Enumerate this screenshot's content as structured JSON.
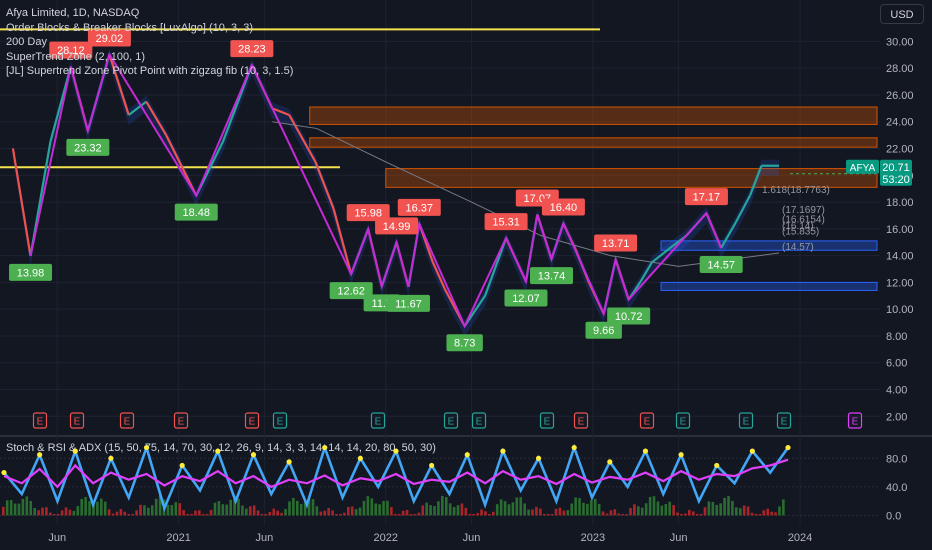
{
  "header": {
    "title": "Afya Limited, 1D, NASDAQ",
    "indicators": [
      "Order Blocks & Breaker Blocks [LuxAlgo] (10, 3, 3)",
      "200 Day",
      "SuperTrend Zone (2, 100, 1)",
      "[JL] Supertrend Zone Pivot Point with zigzag fib (10, 3, 1.5)"
    ],
    "currency_button": "USD"
  },
  "colors": {
    "background": "#131722",
    "grid": "#1f2230",
    "zigzag": "#c62ad6",
    "high_label": "#f05350",
    "low_label": "#4caf50",
    "bull": "#26a69a",
    "bear": "#ef5350",
    "yellow_line": "#f5e34e",
    "orange_zone": "#d35400",
    "blue_zone": "#2962ff",
    "ticker_tag": "#089981"
  },
  "chart_data": [
    {
      "type": "line",
      "title": "Afya Limited, 1D, NASDAQ",
      "ticker": "AFYA",
      "last_price": "20.71",
      "countdown": "53:20",
      "x_axis_labels": [
        "Jun",
        "2021",
        "Jun",
        "2022",
        "Jun",
        "2023",
        "Jun",
        "2024"
      ],
      "y_ticks": [
        2,
        4,
        6,
        8,
        10,
        12,
        14,
        16,
        18,
        20,
        22,
        24,
        26,
        28,
        30
      ],
      "ylim": [
        1.5,
        31
      ],
      "grid": true,
      "x": [
        "2020-03-15",
        "2020-04-15",
        "2020-05-20",
        "2020-06-25",
        "2020-07-25",
        "2020-09-01",
        "2020-10-05",
        "2020-11-05",
        "2020-12-10",
        "2021-02-01",
        "2021-03-20",
        "2021-05-10",
        "2021-06-15",
        "2021-07-15",
        "2021-08-30",
        "2021-10-01",
        "2021-11-01",
        "2021-12-01",
        "2021-12-25",
        "2022-01-20",
        "2022-02-10",
        "2022-03-01",
        "2022-03-25",
        "2022-04-15",
        "2022-05-20",
        "2022-06-25",
        "2022-08-01",
        "2022-09-05",
        "2022-09-25",
        "2022-10-20",
        "2022-11-10",
        "2022-12-01",
        "2022-12-25",
        "2023-01-20",
        "2023-02-10",
        "2023-03-05",
        "2023-03-25",
        "2023-04-15",
        "2023-05-15",
        "2023-06-15",
        "2023-07-20",
        "2023-08-15",
        "2023-09-10",
        "2023-10-05",
        "2023-10-25",
        "2023-11-25"
      ],
      "series": [
        {
          "name": "Close",
          "values": [
            22.0,
            13.98,
            22.5,
            28.12,
            23.32,
            29.02,
            24.5,
            25.5,
            23.0,
            18.48,
            22.5,
            28.23,
            25.0,
            24.5,
            21.0,
            17.5,
            12.62,
            15.98,
            11.7,
            14.99,
            11.67,
            16.37,
            13.5,
            11.5,
            8.73,
            11.0,
            15.31,
            12.07,
            17.07,
            13.74,
            16.4,
            14.5,
            12.0,
            9.66,
            13.71,
            10.72,
            12.0,
            13.5,
            14.5,
            15.5,
            17.17,
            14.57,
            16.5,
            18.5,
            20.71,
            20.71
          ]
        }
      ],
      "zigzag_pivots": [
        {
          "date": "2020-04-15",
          "value": 13.98,
          "label": "13.98",
          "kind": "low"
        },
        {
          "date": "2020-06-25",
          "value": 28.12,
          "label": "28.12",
          "kind": "high"
        },
        {
          "date": "2020-07-25",
          "value": 23.32,
          "label": "23.32",
          "kind": "low"
        },
        {
          "date": "2020-09-01",
          "value": 29.02,
          "label": "29.02",
          "kind": "high"
        },
        {
          "date": "2021-02-01",
          "value": 18.48,
          "label": "18.48",
          "kind": "low"
        },
        {
          "date": "2021-05-10",
          "value": 28.23,
          "label": "28.23",
          "kind": "high"
        },
        {
          "date": "2021-11-01",
          "value": 12.62,
          "label": "12.62",
          "kind": "low"
        },
        {
          "date": "2021-12-01",
          "value": 15.98,
          "label": "15.98",
          "kind": "high"
        },
        {
          "date": "2021-12-25",
          "value": 11.7,
          "label": "11.7",
          "kind": "low"
        },
        {
          "date": "2022-01-20",
          "value": 14.99,
          "label": "14.99",
          "kind": "high"
        },
        {
          "date": "2022-02-10",
          "value": 11.67,
          "label": "11.67",
          "kind": "low"
        },
        {
          "date": "2022-03-01",
          "value": 16.37,
          "label": "16.37",
          "kind": "high"
        },
        {
          "date": "2022-05-20",
          "value": 8.73,
          "label": "8.73",
          "kind": "low"
        },
        {
          "date": "2022-08-01",
          "value": 15.31,
          "label": "15.31",
          "kind": "high"
        },
        {
          "date": "2022-09-05",
          "value": 12.07,
          "label": "12.07",
          "kind": "low"
        },
        {
          "date": "2022-09-25",
          "value": 17.07,
          "label": "17.07",
          "kind": "high"
        },
        {
          "date": "2022-10-20",
          "value": 13.74,
          "label": "13.74",
          "kind": "low"
        },
        {
          "date": "2022-11-10",
          "value": 16.4,
          "label": "16.40",
          "kind": "high"
        },
        {
          "date": "2023-01-20",
          "value": 9.66,
          "label": "9.66",
          "kind": "low"
        },
        {
          "date": "2023-02-10",
          "value": 13.71,
          "label": "13.71",
          "kind": "high"
        },
        {
          "date": "2023-03-05",
          "value": 10.72,
          "label": "10.72",
          "kind": "low"
        },
        {
          "date": "2023-07-20",
          "value": 17.17,
          "label": "17.17",
          "kind": "high"
        },
        {
          "date": "2023-08-15",
          "value": 14.57,
          "label": "14.57",
          "kind": "low"
        }
      ],
      "fib_labels": [
        "1.618(18.7763)",
        "(17.1697)",
        "(16.6154)",
        "(16.14)",
        "(15.835)",
        "(14.57)"
      ],
      "horizontal_levels": [
        {
          "value": 30.9,
          "color": "yellow"
        },
        {
          "value": 20.6,
          "color": "yellow"
        }
      ],
      "zones": [
        {
          "from": 23.8,
          "to": 25.1,
          "color": "orange"
        },
        {
          "from": 22.1,
          "to": 22.8,
          "color": "orange"
        },
        {
          "from": 19.1,
          "to": 20.5,
          "color": "orange"
        },
        {
          "from": 14.4,
          "to": 15.1,
          "color": "blue"
        },
        {
          "from": 11.4,
          "to": 12.0,
          "color": "blue"
        }
      ],
      "event_markers": [
        "E",
        "E",
        "E",
        "E",
        "E",
        "E",
        "E",
        "E",
        "E",
        "E",
        "E",
        "E",
        "E",
        "E",
        "E",
        "E",
        "E"
      ]
    },
    {
      "type": "line",
      "title": "Stoch & RSI & ADX (15, 50, 75, 14, 70, 30, 12, 26, 9, 14, 3, 3, 14, 14, 14, 20, 80, 50, 30)",
      "y_ticks": [
        "80.0",
        "40.0",
        "0.0"
      ],
      "ylim": [
        -5,
        100
      ],
      "series": [
        {
          "name": "Stoch",
          "values": [
            60,
            30,
            85,
            20,
            90,
            15,
            80,
            25,
            95,
            10,
            70,
            35,
            90,
            20,
            85,
            30,
            75,
            15,
            95,
            25,
            80,
            40,
            90,
            20,
            70,
            30,
            85,
            15,
            90,
            35,
            80,
            20,
            95,
            25,
            75,
            40,
            90,
            30,
            85,
            20,
            70,
            45,
            90,
            60,
            95
          ]
        },
        {
          "name": "RSI",
          "values": [
            55,
            45,
            65,
            40,
            70,
            45,
            60,
            50,
            58,
            42,
            55,
            48,
            62,
            45,
            55,
            40,
            50,
            45,
            56,
            42,
            52,
            48,
            58,
            44,
            50,
            47,
            60,
            45,
            62,
            50,
            55,
            44,
            58,
            46,
            54,
            50,
            60,
            48,
            62,
            50,
            58,
            55,
            66,
            70,
            78
          ]
        }
      ]
    }
  ]
}
